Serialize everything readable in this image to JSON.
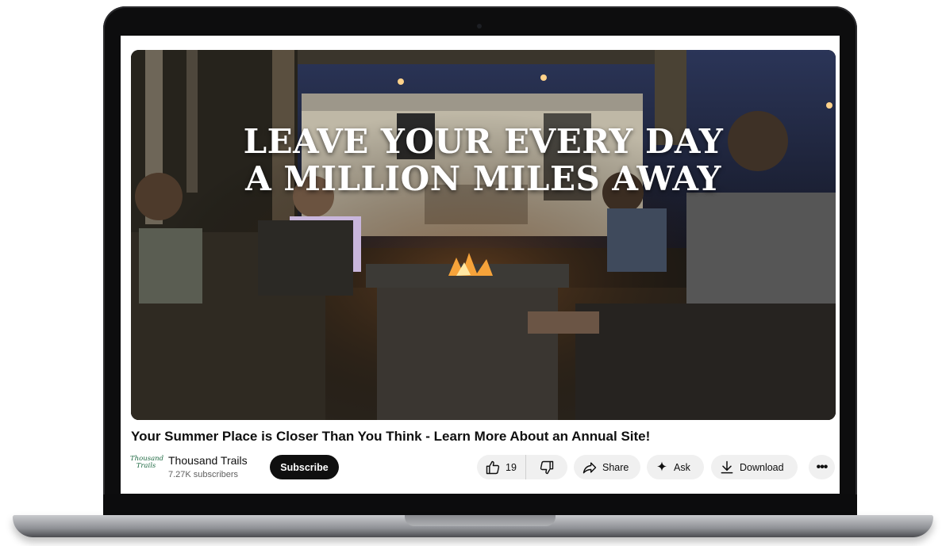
{
  "video": {
    "headline_line1": "LEAVE YOUR EVERY DAY",
    "headline_line2": "A MILLION MILES AWAY",
    "title": "Your Summer Place is Closer Than You Think - Learn More About an Annual Site!"
  },
  "channel": {
    "logo_line1": "Thousand",
    "logo_line2": "Trails",
    "name": "Thousand Trails",
    "subscribers": "7.27K subscribers",
    "subscribe_label": "Subscribe"
  },
  "actions": {
    "like_count": "19",
    "share_label": "Share",
    "ask_label": "Ask",
    "download_label": "Download",
    "more_label": "•••"
  },
  "icons": {
    "like": "thumbs-up-icon",
    "dislike": "thumbs-down-icon",
    "share": "share-arrow-icon",
    "ask": "sparkle-icon",
    "download": "download-icon",
    "more": "more-horizontal-icon"
  },
  "colors": {
    "subscribe_bg": "#0f0f0f",
    "pill_bg": "#f0f0f0",
    "logo_green": "#1f6a43"
  }
}
